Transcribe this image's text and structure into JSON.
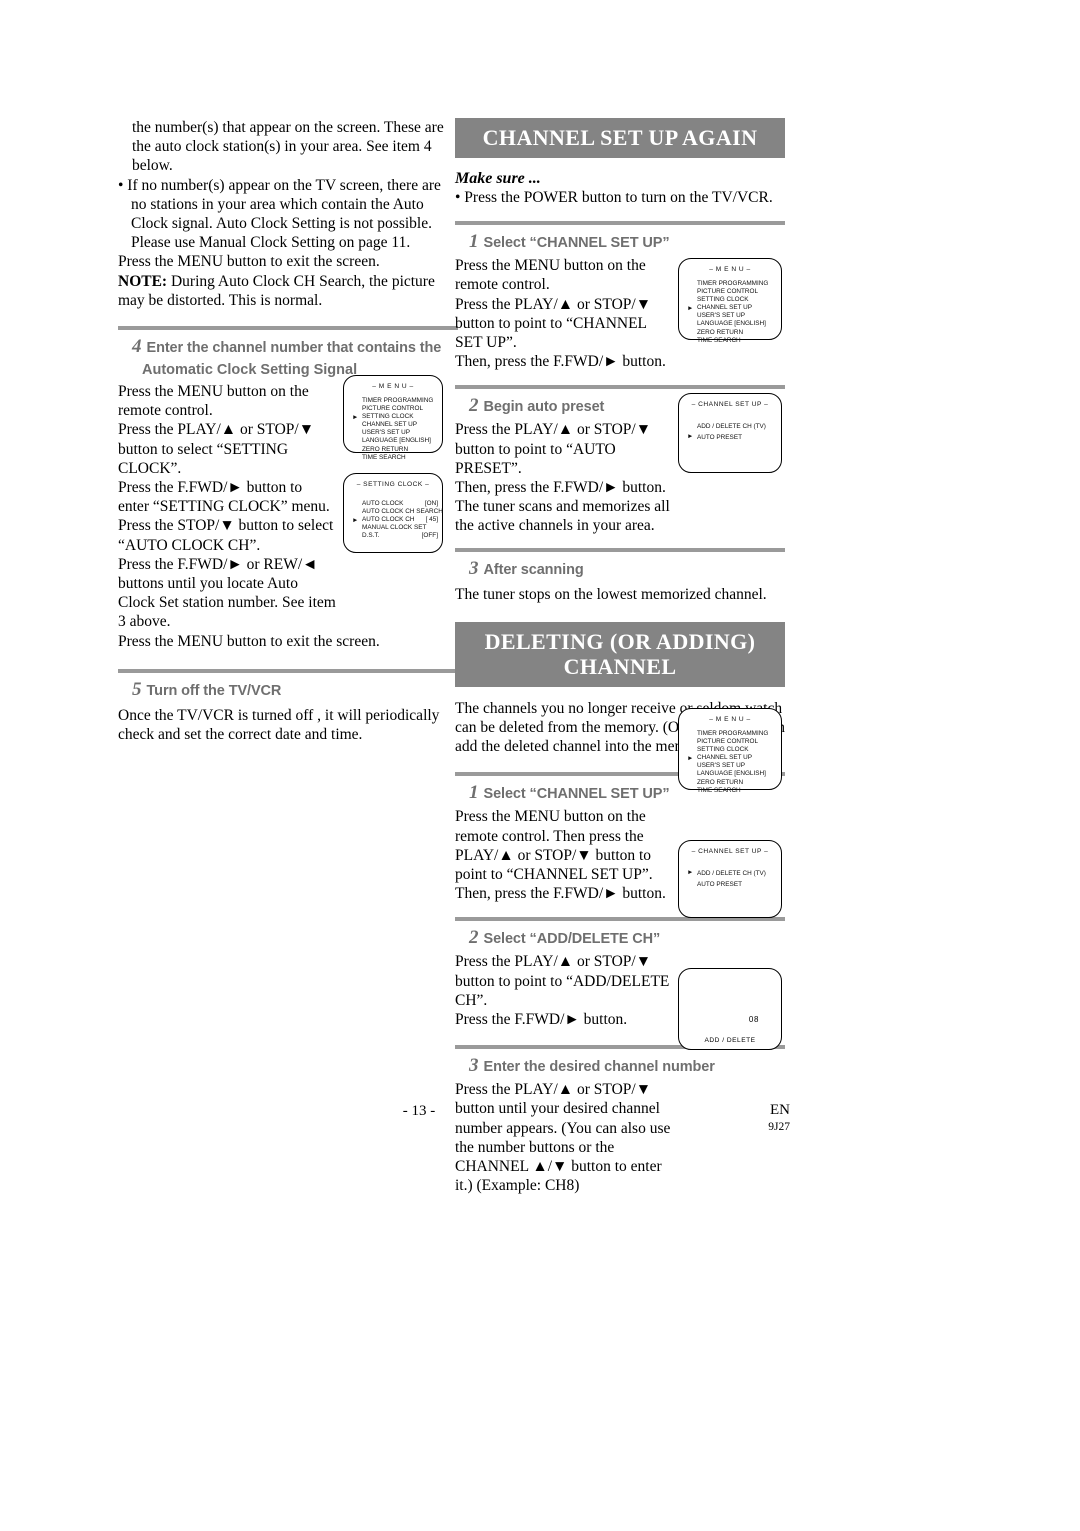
{
  "left_column": {
    "top_paragraphs": [
      "the number(s) that appear on the screen. These are the auto clock station(s) in your area. See item 4 below.",
      "• If no number(s) appear on the TV screen, there are no stations in your area which contain the Auto Clock signal. Auto Clock Setting is not possible. Please use Manual Clock Setting on page 11.",
      "Press the MENU button to exit the screen."
    ],
    "note_label": "NOTE:",
    "note_text": " During Auto Clock CH Search, the picture may be distorted. This is normal.",
    "step4": {
      "number": "4",
      "label_line1": "Enter the channel number that contains the",
      "label_line2": "Automatic Clock Setting Signal",
      "paragraphs": [
        "Press the MENU button on the remote control.",
        "Press the PLAY/▲ or STOP/▼ button to select “SETTING CLOCK”.",
        "Press the F.FWD/► button to enter “SETTING CLOCK” menu.",
        "Press the STOP/▼ button to select “AUTO CLOCK CH”.",
        "Press the F.FWD/► or REW/◄ buttons until you locate Auto Clock Set station number. See item 3 above.",
        "Press the MENU button to exit the screen."
      ]
    },
    "step5": {
      "number": "5",
      "label": "Turn off the TV/VCR",
      "paragraph": "Once the TV/VCR is turned off , it will periodically check and set the correct date and time."
    },
    "osd_menu": {
      "title": "– M E N U –",
      "items": [
        {
          "label": "TIMER PROGRAMMING",
          "cursor": false,
          "value": ""
        },
        {
          "label": "PICTURE CONTROL",
          "cursor": false,
          "value": ""
        },
        {
          "label": "SETTING CLOCK",
          "cursor": true,
          "value": ""
        },
        {
          "label": "CHANNEL SET UP",
          "cursor": false,
          "value": ""
        },
        {
          "label": "USER'S SET UP",
          "cursor": false,
          "value": ""
        },
        {
          "label": "LANGUAGE  [ENGLISH]",
          "cursor": false,
          "value": ""
        },
        {
          "label": "ZERO RETURN",
          "cursor": false,
          "value": ""
        },
        {
          "label": "TIME SEARCH",
          "cursor": false,
          "value": ""
        }
      ]
    },
    "osd_setting_clock": {
      "title": "– SETTING CLOCK –",
      "items": [
        {
          "label": "AUTO CLOCK",
          "cursor": false,
          "value": "[ON]"
        },
        {
          "label": "AUTO CLOCK CH SEARCH",
          "cursor": false,
          "value": ""
        },
        {
          "label": "AUTO CLOCK CH",
          "cursor": true,
          "value": "[  45]"
        },
        {
          "label": "MANUAL CLOCK SET",
          "cursor": false,
          "value": ""
        },
        {
          "label": "D.S.T.",
          "cursor": false,
          "value": "[OFF]"
        }
      ]
    }
  },
  "right_column": {
    "section1_title": "CHANNEL SET UP AGAIN",
    "make_sure_label": "Make sure ...",
    "make_sure_item": "• Press the POWER button to turn on the TV/VCR.",
    "s1_step1": {
      "number": "1",
      "label": "Select “CHANNEL SET UP”",
      "paragraphs": [
        "Press the MENU button on the remote control.",
        "Press the PLAY/▲ or STOP/▼ button to point to “CHANNEL SET UP”.",
        "Then, press the F.FWD/► button."
      ]
    },
    "s1_step2": {
      "number": "2",
      "label": "Begin auto preset",
      "paragraphs": [
        "Press the PLAY/▲ or STOP/▼ button to point to “AUTO PRESET”.",
        "Then, press the F.FWD/► button.",
        "The tuner scans and memorizes all the active channels in your area."
      ]
    },
    "s1_step3": {
      "number": "3",
      "label": "After scanning",
      "paragraphs": [
        "The tuner stops on the lowest memorized channel."
      ]
    },
    "section2_title_line1": "DELETING (OR ADDING)",
    "section2_title_line2": "CHANNEL",
    "section2_intro": "The channels you no longer receive or seldom watch can be deleted from the memory. (Of course, you can add the deleted channel into the memory again.)",
    "s2_step1": {
      "number": "1",
      "label": "Select “CHANNEL SET UP”",
      "paragraphs": [
        "Press the MENU button on the remote control. Then press the PLAY/▲ or STOP/▼ button to point to “CHANNEL SET UP”.",
        "Then, press the F.FWD/► button."
      ]
    },
    "s2_step2": {
      "number": "2",
      "label": "Select “ADD/DELETE CH”",
      "paragraphs": [
        "Press the PLAY/▲ or STOP/▼ button to point to “ADD/DELETE CH”.",
        "Press the F.FWD/► button."
      ]
    },
    "s2_step3": {
      "number": "3",
      "label": "Enter the desired channel number",
      "paragraphs": [
        "Press the PLAY/▲ or STOP/▼ button until your desired channel number appears. (You can also use the number buttons  or the CHANNEL ▲/▼ button to enter it.) (Example: CH8)"
      ]
    },
    "osd_menu_a": {
      "title": "– M E N U –",
      "items": [
        {
          "label": "TIMER PROGRAMMING",
          "cursor": false,
          "value": ""
        },
        {
          "label": "PICTURE CONTROL",
          "cursor": false,
          "value": ""
        },
        {
          "label": "SETTING CLOCK",
          "cursor": false,
          "value": ""
        },
        {
          "label": "CHANNEL SET UP",
          "cursor": true,
          "value": ""
        },
        {
          "label": "USER'S SET UP",
          "cursor": false,
          "value": ""
        },
        {
          "label": "LANGUAGE  [ENGLISH]",
          "cursor": false,
          "value": ""
        },
        {
          "label": "ZERO RETURN",
          "cursor": false,
          "value": ""
        },
        {
          "label": "TIME SEARCH",
          "cursor": false,
          "value": ""
        }
      ]
    },
    "osd_channel_setup_a": {
      "title": "– CHANNEL SET UP –",
      "items": [
        {
          "label": "ADD / DELETE CH (TV)",
          "cursor": false,
          "value": ""
        },
        {
          "label": "AUTO PRESET",
          "cursor": true,
          "value": ""
        }
      ]
    },
    "osd_menu_b": {
      "title": "– M E N U –",
      "items": [
        {
          "label": "TIMER PROGRAMMING",
          "cursor": false,
          "value": ""
        },
        {
          "label": "PICTURE CONTROL",
          "cursor": false,
          "value": ""
        },
        {
          "label": "SETTING CLOCK",
          "cursor": false,
          "value": ""
        },
        {
          "label": "CHANNEL SET UP",
          "cursor": true,
          "value": ""
        },
        {
          "label": "USER'S SET UP",
          "cursor": false,
          "value": ""
        },
        {
          "label": "LANGUAGE  [ENGLISH]",
          "cursor": false,
          "value": ""
        },
        {
          "label": "ZERO RETURN",
          "cursor": false,
          "value": ""
        },
        {
          "label": "TIME SEARCH",
          "cursor": false,
          "value": ""
        }
      ]
    },
    "osd_channel_setup_b": {
      "title": "– CHANNEL SET UP –",
      "items": [
        {
          "label": "ADD / DELETE CH (TV)",
          "cursor": true,
          "value": ""
        },
        {
          "label": "AUTO PRESET",
          "cursor": false,
          "value": ""
        }
      ]
    },
    "osd_add_delete": {
      "channel": "08",
      "caption": "ADD / DELETE"
    }
  },
  "footer": {
    "page_number": "- 13 -",
    "language_code": "EN",
    "doc_code": "9J27"
  },
  "colors": {
    "heading_bar": "#848484",
    "divider": "#9a9a9a",
    "step_label": "#6f6f6f"
  }
}
